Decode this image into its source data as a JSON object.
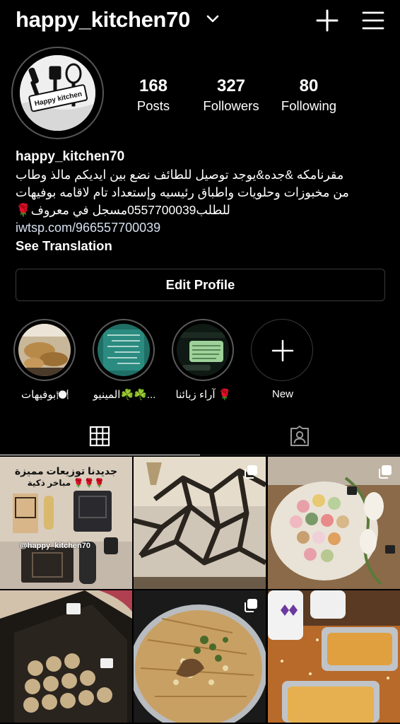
{
  "header": {
    "username": "happy_kitchen70"
  },
  "profile": {
    "avatar_text": "Happy kitchen",
    "stats": [
      {
        "value": "168",
        "label": "Posts"
      },
      {
        "value": "327",
        "label": "Followers"
      },
      {
        "value": "80",
        "label": "Following"
      }
    ]
  },
  "bio": {
    "name": "happy_kitchen70",
    "lines": [
      "مقرنامكه &جده&يوجد توصيل للطائف نضع بين ايديكم مالذ وطاب",
      "من مخبوزات وحلويات واطباق رئيسيه وإستعداد تام لاقامه بوفيهات",
      "للطلب0557700039مسجل في معروف🌹"
    ],
    "link": "iwtsp.com/966557700039",
    "see_translation": "See Translation"
  },
  "edit_profile_label": "Edit Profile",
  "highlights": [
    {
      "label": "بوفيهات🍽️"
    },
    {
      "label": "المينيو☘️☘️..."
    },
    {
      "label": "آراء زبائنا 🌹"
    },
    {
      "label": "New"
    }
  ],
  "posts": {
    "post1": {
      "caption_line1": "جديدنا توزيعات مميزة",
      "caption_line2": "مباخر ذكية 🌹🌹🌹",
      "watermark": "@happy_kitchen70"
    }
  },
  "colors": {
    "background": "#000000",
    "text": "#ffffff",
    "link": "#d6e0f0",
    "border": "#3a3a3a"
  }
}
